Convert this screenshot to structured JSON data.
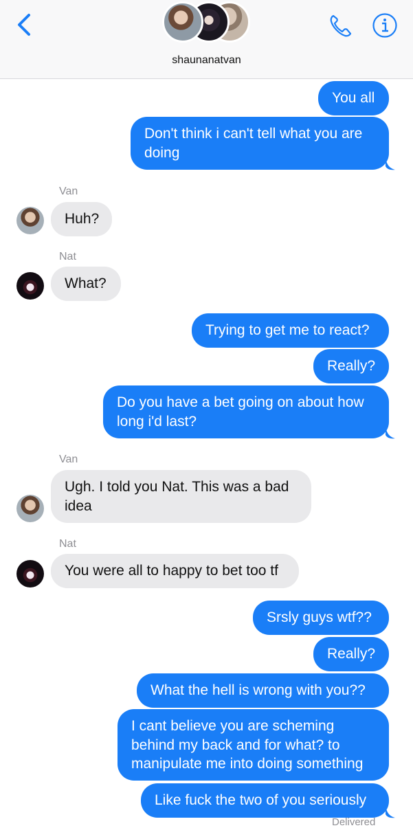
{
  "header": {
    "group_name": "shaunanatvan",
    "back_icon": "chevron-left-icon",
    "phone_icon": "phone-icon",
    "info_icon": "info-icon",
    "accent": "#1a7ef7"
  },
  "messages": [
    {
      "dir": "out",
      "text": "You all"
    },
    {
      "dir": "out",
      "lines": [
        "Don't think i can't tell what you are",
        "doing"
      ]
    },
    {
      "dir": "in",
      "sender": "Van",
      "text": "Huh?"
    },
    {
      "dir": "in",
      "sender": "Nat",
      "text": "What?"
    },
    {
      "dir": "out",
      "text": "Trying to get me to react?"
    },
    {
      "dir": "out",
      "text": "Really?"
    },
    {
      "dir": "out",
      "lines": [
        "Do you have a bet going on about how",
        "long i'd last?"
      ]
    },
    {
      "dir": "in",
      "sender": "Van",
      "lines": [
        "Ugh. I told you Nat. This was a bad",
        "idea"
      ]
    },
    {
      "dir": "in",
      "sender": "Nat",
      "text": "You were all to happy to bet too tf"
    },
    {
      "dir": "out",
      "text": "Srsly guys wtf??"
    },
    {
      "dir": "out",
      "text": "Really?"
    },
    {
      "dir": "out",
      "text": "What the hell is wrong with you??"
    },
    {
      "dir": "out",
      "lines": [
        "I cant believe you are scheming",
        "behind my back and for what? to",
        "manipulate me into doing something"
      ]
    },
    {
      "dir": "out",
      "text": "Like fuck the two of you seriously"
    }
  ],
  "status": {
    "delivered": "Delivered"
  },
  "colors": {
    "outgoing": "#1a7ef7",
    "incoming": "#e9e9eb",
    "sender_label": "#8e8e93"
  }
}
